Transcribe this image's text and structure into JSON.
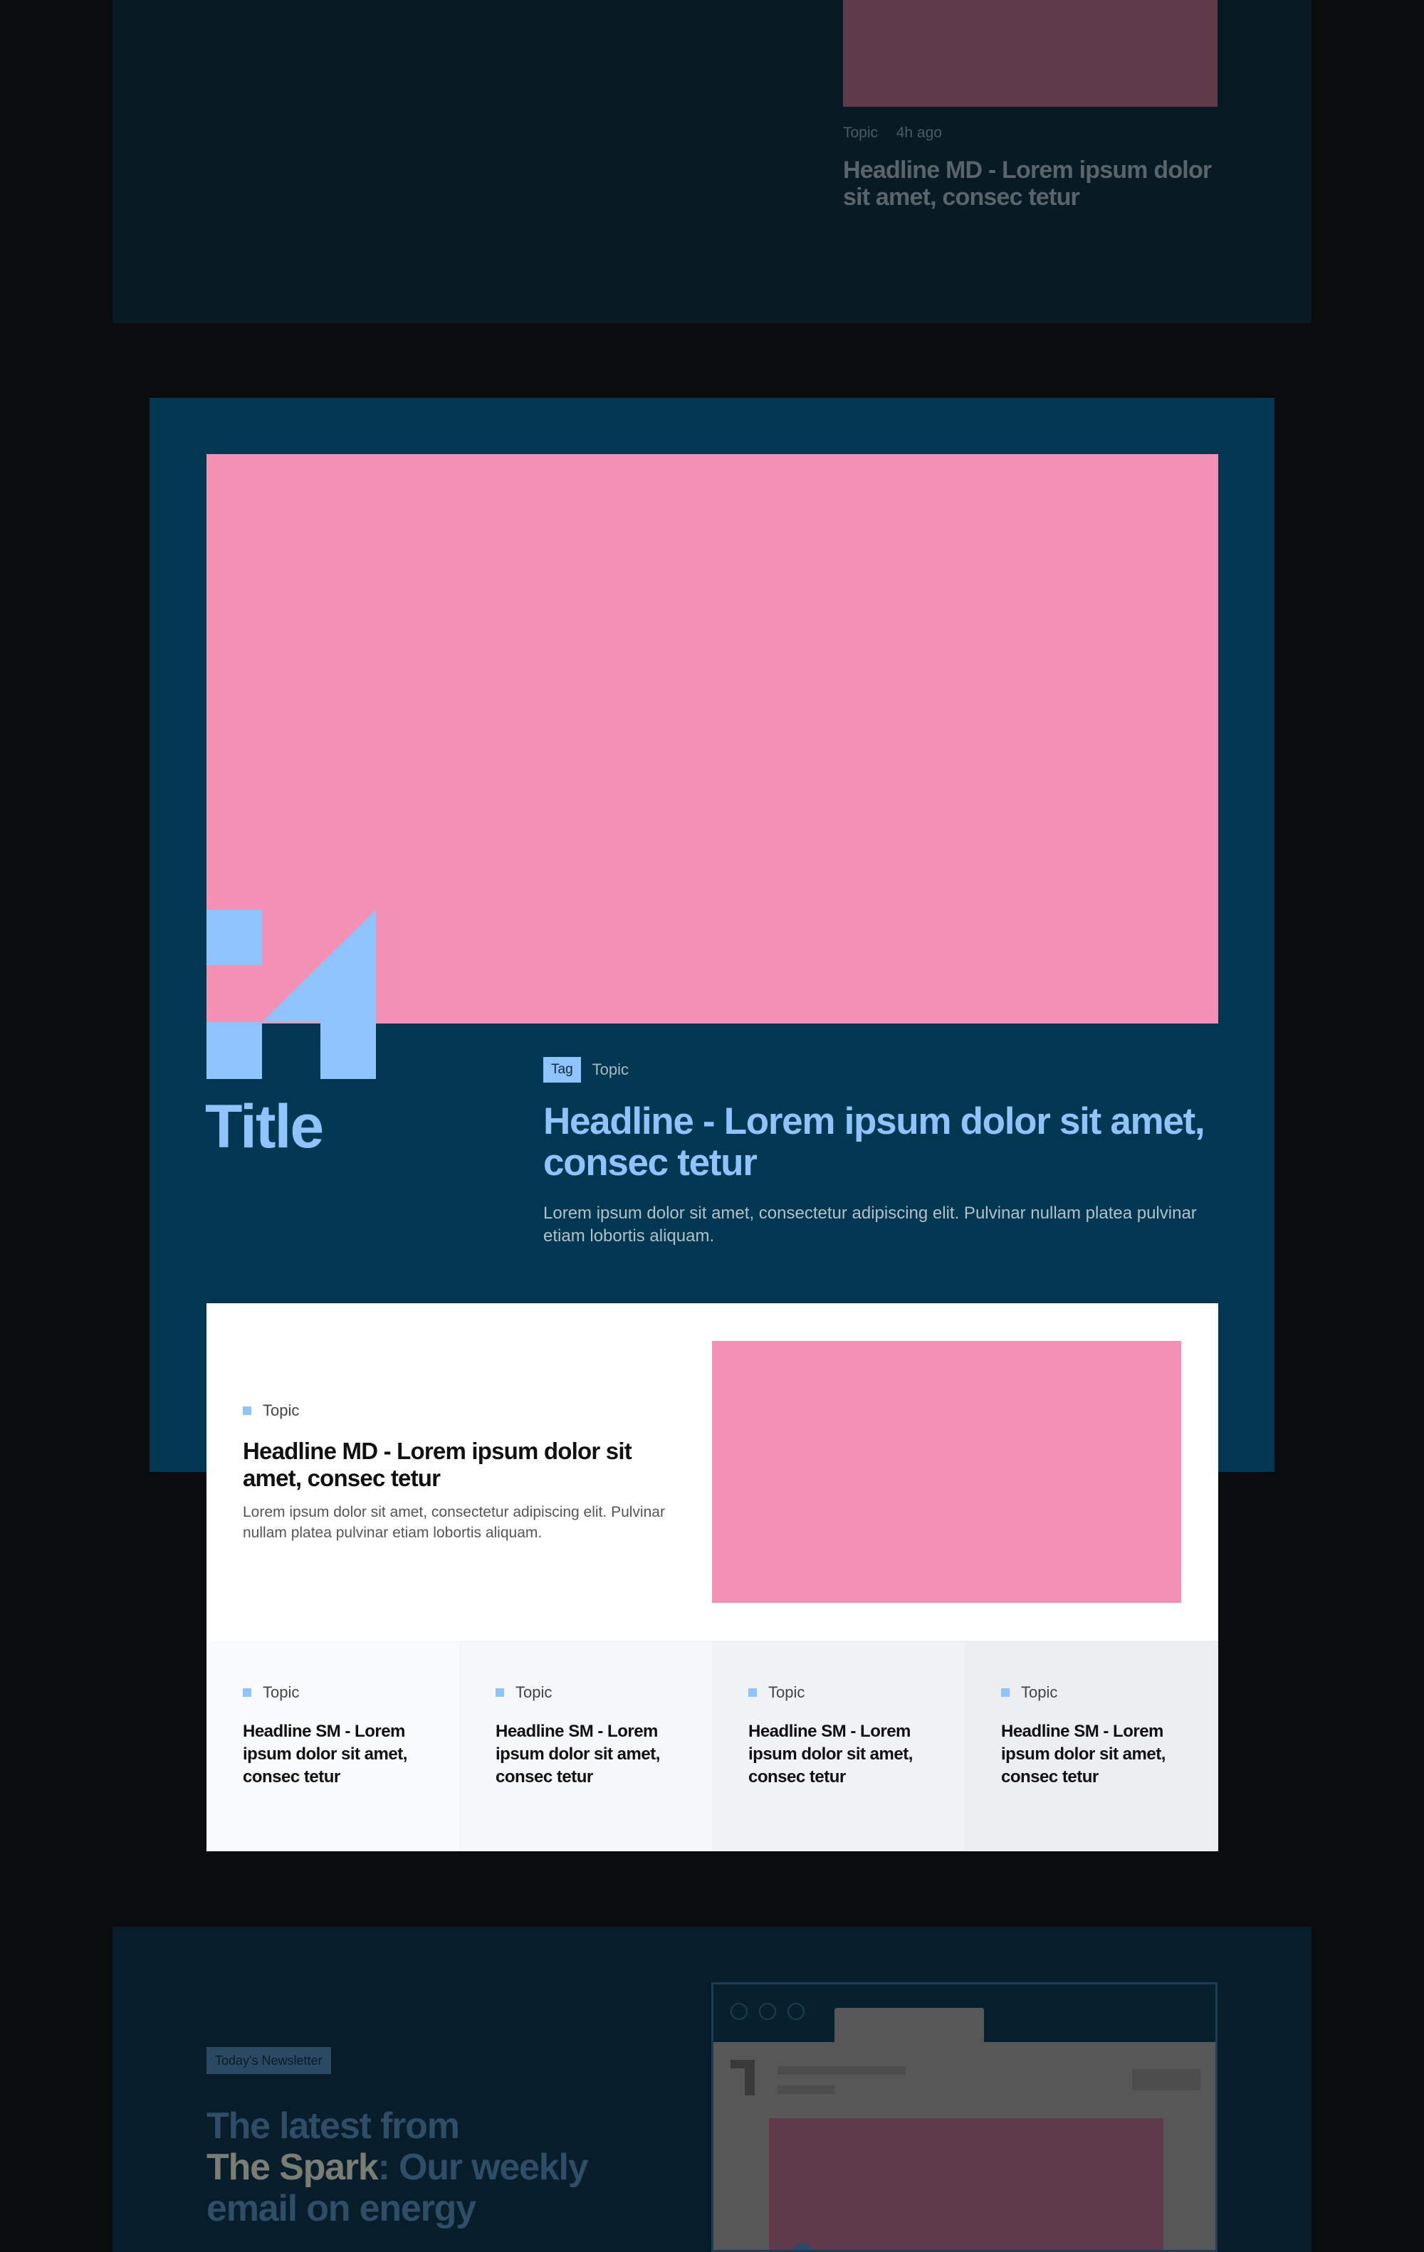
{
  "colors": {
    "page_bg": "#0b0c0d",
    "feature_bg": "#013750",
    "pink": "#f490b4",
    "light_blue": "#8fc3fb",
    "white": "#ffffff",
    "dim_panel": "#081d2a"
  },
  "prev_section": {
    "meta": {
      "topic": "Topic",
      "time": "4h ago"
    },
    "headline": "Headline MD - Lorem ipsum dolor sit amet, consec tetur"
  },
  "feature": {
    "logo_icon": "h-shaped-logo",
    "title": "Title",
    "tag": "Tag",
    "topic": "Topic",
    "headline": "Headline - Lorem ipsum dolor sit amet, consec tetur",
    "body": "Lorem ipsum dolor sit amet, consectetur adipiscing elit. Pulvinar nullam platea pulvinar etiam lobortis aliquam."
  },
  "card_md": {
    "topic": "Topic",
    "headline": "Headline MD - Lorem ipsum dolor sit amet, consec tetur",
    "body": "Lorem ipsum dolor sit amet, consectetur adipiscing elit. Pulvinar nullam platea pulvinar etiam lobortis aliquam."
  },
  "cards_sm": [
    {
      "topic": "Topic",
      "headline": "Headline SM - Lorem ipsum dolor sit amet, consec tetur",
      "bg": "#f9fafb"
    },
    {
      "topic": "Topic",
      "headline": "Headline SM - Lorem ipsum dolor sit amet, consec tetur",
      "bg": "#f5f6f8"
    },
    {
      "topic": "Topic",
      "headline": "Headline SM - Lorem ipsum dolor sit amet, consec tetur",
      "bg": "#f1f2f5"
    },
    {
      "topic": "Topic",
      "headline": "Headline SM - Lorem ipsum dolor sit amet, consec tetur",
      "bg": "#eceef1"
    }
  ],
  "newsletter": {
    "badge": "Today's Newsletter",
    "line1": "The latest from",
    "brand": "The Spark",
    "line2": ": Our weekly",
    "line3": "email on energy"
  }
}
